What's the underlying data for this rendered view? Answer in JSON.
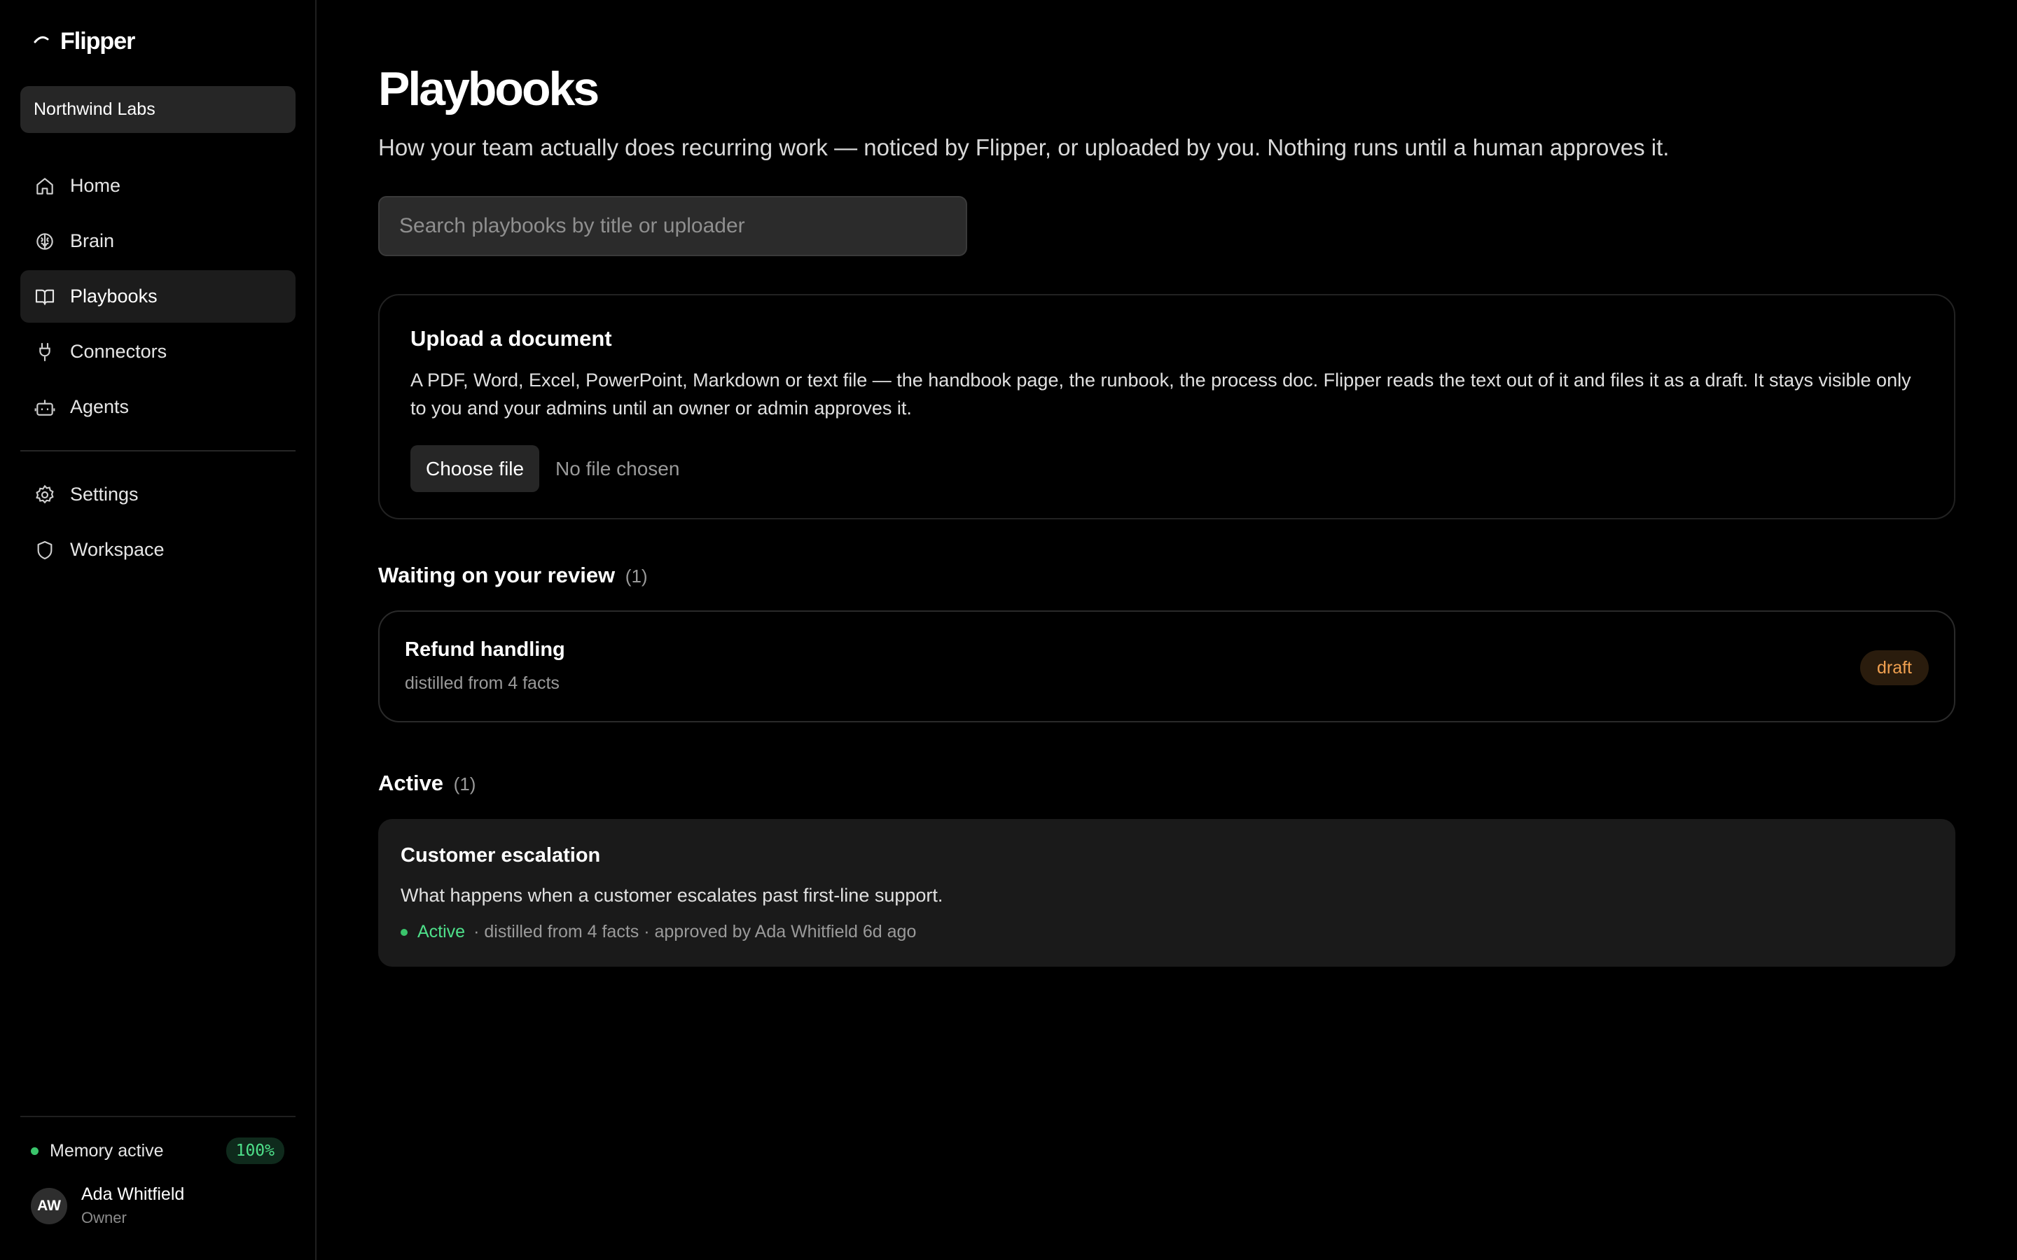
{
  "app": {
    "name": "Flipper"
  },
  "workspace": {
    "name": "Northwind Labs"
  },
  "nav": {
    "items": [
      {
        "label": "Home",
        "icon": "home-icon"
      },
      {
        "label": "Brain",
        "icon": "brain-icon"
      },
      {
        "label": "Playbooks",
        "icon": "book-icon",
        "active": true
      },
      {
        "label": "Connectors",
        "icon": "plug-icon"
      },
      {
        "label": "Agents",
        "icon": "robot-icon"
      }
    ],
    "secondary": [
      {
        "label": "Settings",
        "icon": "gear-icon"
      },
      {
        "label": "Workspace",
        "icon": "shield-icon"
      }
    ]
  },
  "memory": {
    "label": "Memory active",
    "percent": "100%"
  },
  "user": {
    "initials": "AW",
    "name": "Ada Whitfield",
    "role": "Owner"
  },
  "page": {
    "title": "Playbooks",
    "subtitle": "How your team actually does recurring work — noticed by Flipper, or uploaded by you. Nothing runs until a human approves it."
  },
  "search": {
    "placeholder": "Search playbooks by title or uploader",
    "value": ""
  },
  "upload": {
    "title": "Upload a document",
    "description": "A PDF, Word, Excel, PowerPoint, Markdown or text file — the handbook page, the runbook, the process doc. Flipper reads the text out of it and files it as a draft. It stays visible only to you and your admins until an owner or admin approves it.",
    "button_label": "Choose file",
    "file_status": "No file chosen"
  },
  "review": {
    "heading": "Waiting on your review",
    "count": "(1)",
    "items": [
      {
        "title": "Refund handling",
        "meta": "distilled from 4 facts",
        "badge": "draft"
      }
    ]
  },
  "active": {
    "heading": "Active",
    "count": "(1)",
    "items": [
      {
        "title": "Customer escalation",
        "description": "What happens when a customer escalates past first-line support.",
        "status": "Active",
        "meta": "· distilled from 4 facts · approved by Ada Whitfield 6d ago"
      }
    ]
  },
  "colors": {
    "background": "#000000",
    "accent_green": "#3ac46b",
    "draft_orange": "#f0a050",
    "card_bg": "#1a1a1a"
  }
}
